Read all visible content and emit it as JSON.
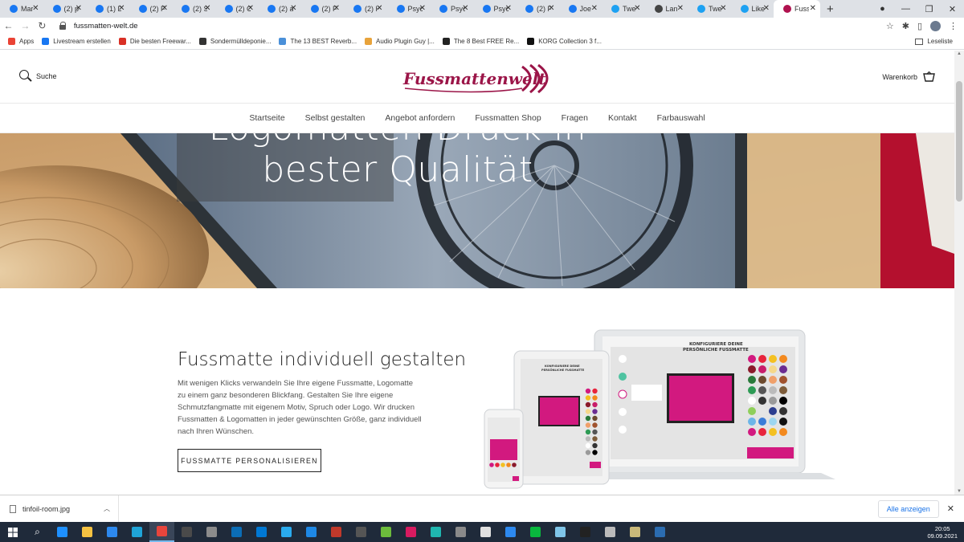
{
  "browser": {
    "tabs": [
      {
        "title": "Mar",
        "icon": "facebook-icon",
        "color": "#1877f2"
      },
      {
        "title": "(2) p",
        "icon": "facebook-icon",
        "color": "#1877f2"
      },
      {
        "title": "(1) D",
        "icon": "facebook-icon",
        "color": "#1877f2"
      },
      {
        "title": "(2) F",
        "icon": "facebook-icon",
        "color": "#1877f2"
      },
      {
        "title": "(2) S",
        "icon": "facebook-icon",
        "color": "#1877f2"
      },
      {
        "title": "(2) C",
        "icon": "facebook-icon",
        "color": "#1877f2"
      },
      {
        "title": "(2) a",
        "icon": "facebook-icon",
        "color": "#1877f2"
      },
      {
        "title": "(2) F",
        "icon": "facebook-icon",
        "color": "#1877f2"
      },
      {
        "title": "(2) H",
        "icon": "facebook-icon",
        "color": "#1877f2"
      },
      {
        "title": "Psyc",
        "icon": "facebook-icon",
        "color": "#1877f2"
      },
      {
        "title": "Psyc",
        "icon": "facebook-icon",
        "color": "#1877f2"
      },
      {
        "title": "Psyc",
        "icon": "facebook-icon",
        "color": "#1877f2"
      },
      {
        "title": "(2) F",
        "icon": "facebook-icon",
        "color": "#1877f2"
      },
      {
        "title": "Joe",
        "icon": "facebook-icon",
        "color": "#1877f2"
      },
      {
        "title": "Twe",
        "icon": "twitter-icon",
        "color": "#1da1f2"
      },
      {
        "title": "Lan",
        "icon": "globe-icon",
        "color": "#444444"
      },
      {
        "title": "Twe",
        "icon": "twitter-icon",
        "color": "#1da1f2"
      },
      {
        "title": "Like",
        "icon": "twitter-icon",
        "color": "#1da1f2"
      },
      {
        "title": "Fuss",
        "icon": "fussmatten-icon",
        "color": "#b0124f",
        "active": true
      }
    ],
    "url": "fussmatten-welt.de",
    "bookmarks": [
      {
        "label": "Apps",
        "icon": "apps-grid-icon",
        "color": "#ea4335"
      },
      {
        "label": "Livestream erstellen",
        "icon": "facebook-icon",
        "color": "#1877f2"
      },
      {
        "label": "Die besten Freewar...",
        "icon": "star-icon",
        "color": "#d93025"
      },
      {
        "label": "Sondermülldeponie...",
        "icon": "w-icon",
        "color": "#333333"
      },
      {
        "label": "The 13 BEST Reverb...",
        "icon": "wave-icon",
        "color": "#4a90d9"
      },
      {
        "label": "Audio Plugin Guy |...",
        "icon": "plug-icon",
        "color": "#e8a33b"
      },
      {
        "label": "The 8 Best FREE Re...",
        "icon": "moon-icon",
        "color": "#222222"
      },
      {
        "label": "KORG Collection 3 f...",
        "icon": "korg-icon",
        "color": "#111111"
      }
    ],
    "reading_list": "Leseliste"
  },
  "site": {
    "search_label": "Suche",
    "logo_text": "Fussmattenwelt",
    "cart_label": "Warenkorb",
    "nav": [
      "Startseite",
      "Selbst gestalten",
      "Angebot anfordern",
      "Fussmatten Shop",
      "Fragen",
      "Kontakt",
      "Farbauswahl"
    ],
    "hero_line1": "Logomatten Druck in",
    "hero_line2": "bester Qualität",
    "section_title": "Fussmatte individuell gestalten",
    "section_text": "Mit wenigen Klicks verwandeln Sie Ihre eigene Fussmatte, Logomatte zu einem ganz besonderen Blickfang. Gestalten Sie Ihre eigene Schmutzfangmatte mit eigenem Motiv, Spruch oder Logo. Wir drucken Fussmatten & Logomatten in jeder gewünschten Größe, ganz individuell nach Ihren Wünschen.",
    "cta_label": "FUSSMATTE PERSONALISIEREN",
    "mockup_heading_1": "KONFIGURIERE DEINE",
    "mockup_heading_2": "PERSÖNLICHE FUSSMATTE",
    "accent": "#d2197f"
  },
  "downloads": {
    "file": "tinfoil-room.jpg",
    "show_all": "Alle anzeigen"
  },
  "taskbar": {
    "time": "20:05",
    "date": "09.09.2021"
  }
}
